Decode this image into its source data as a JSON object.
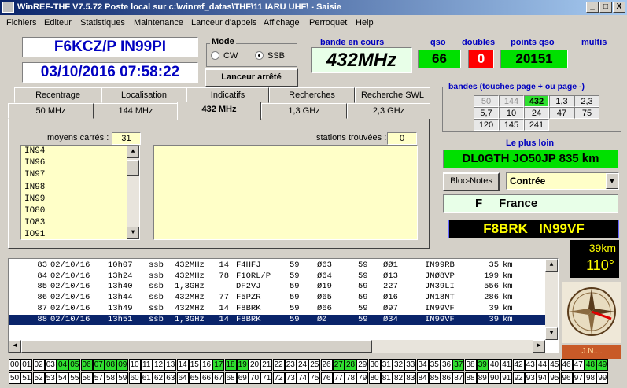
{
  "window": {
    "title": "WinREF-THF V7.5.72 Poste local sur c:\\winref_datas\\THF\\11 IARU UHF\\ -  Saisie",
    "min": "_",
    "max": "□",
    "close": "X"
  },
  "menu": [
    "Fichiers",
    "Editeur",
    "Statistiques",
    "Maintenance",
    "Lanceur d'appels",
    "Affichage",
    "Perroquet",
    "Help"
  ],
  "station": {
    "callsign": "F6KCZ/P  IN99PI",
    "datetime": "03/10/2016   07:58:22"
  },
  "mode": {
    "label": "Mode",
    "cw": "CW",
    "ssb": "SSB",
    "selected": "SSB"
  },
  "launcher_button": "Lanceur arrêté",
  "band": {
    "label": "bande en cours",
    "value": "432MHz"
  },
  "qso": {
    "label": "qso",
    "value": "66"
  },
  "doubles": {
    "label": "doubles",
    "value": "0"
  },
  "points": {
    "label": "points qso",
    "value": "20151"
  },
  "multis": {
    "label": "multis"
  },
  "tabs_top": [
    "Recentrage",
    "Localisation",
    "Indicatifs",
    "Recherches",
    "Recherche SWL"
  ],
  "tabs_bands": [
    "50 MHz",
    "144 MHz",
    "432 MHz",
    "1,3 GHz",
    "2,3 GHz"
  ],
  "active_band_tab": "432 MHz",
  "squares": {
    "label": "moyens carrés :",
    "count": "31",
    "items": [
      "IN94",
      "IN96",
      "IN97",
      "IN98",
      "IN99",
      "IO80",
      "IO83",
      "IO91"
    ]
  },
  "stations": {
    "label": "stations trouvées :",
    "count": "0"
  },
  "bands_panel": {
    "title": "bandes (touches page + ou page -)",
    "rows": [
      [
        "50",
        "144",
        "432",
        "1,3",
        "2,3"
      ],
      [
        "5,7",
        "10",
        "24",
        "47",
        "75"
      ],
      [
        "120",
        "145",
        "241"
      ]
    ],
    "active": "432",
    "greyed": [
      "50",
      "144"
    ]
  },
  "farthest": {
    "label": "Le plus loin",
    "value": "DL0GTH JO50JP  835 km"
  },
  "notes_button": "Bloc-Notes",
  "contest_select": "Contrée",
  "country": "F     France",
  "current": {
    "call": "F8BRK   IN99VF",
    "distance": "39km",
    "bearing": "110°"
  },
  "compass_label": "J.N....",
  "log": [
    [
      "83",
      "02/10/16",
      "10h07",
      "ssb",
      "432MHz",
      "14",
      "F4HFJ",
      "59",
      "Ø63",
      "59",
      "ØØ1",
      "IN99RB",
      "35",
      "km"
    ],
    [
      "84",
      "02/10/16",
      "13h24",
      "ssb",
      "432MHz",
      "78",
      "F1ORL/P",
      "59",
      "Ø64",
      "59",
      "Ø13",
      "JNØ8VP",
      "199",
      "km"
    ],
    [
      "85",
      "02/10/16",
      "13h40",
      "ssb",
      "1,3GHz",
      "",
      "DF2VJ",
      "59",
      "Ø19",
      "59",
      "227",
      "JN39LI",
      "556",
      "km"
    ],
    [
      "86",
      "02/10/16",
      "13h44",
      "ssb",
      "432MHz",
      "77",
      "F5PZR",
      "59",
      "Ø65",
      "59",
      "Ø16",
      "JN18NT",
      "286",
      "km"
    ],
    [
      "87",
      "02/10/16",
      "13h49",
      "ssb",
      "432MHz",
      "14",
      "F8BRK",
      "59",
      "Ø66",
      "59",
      "Ø97",
      "IN99VF",
      "39",
      "km"
    ],
    [
      "88",
      "02/10/16",
      "13h51",
      "ssb",
      "1,3GHz",
      "14",
      "F8BRK",
      "59",
      "ØØ",
      "59",
      "Ø34",
      "IN99VF",
      "39",
      "km"
    ]
  ],
  "selected_log_row": "88",
  "scroll": {
    "up": "▲",
    "down": "▼",
    "left": "◄",
    "right": "►"
  },
  "departments": {
    "row1": [
      "00",
      "01",
      "02",
      "03",
      "04",
      "05",
      "06",
      "07",
      "08",
      "09",
      "10",
      "11",
      "12",
      "13",
      "14",
      "15",
      "16",
      "17",
      "18",
      "19",
      "20",
      "21",
      "22",
      "23",
      "24",
      "25",
      "26",
      "27",
      "28",
      "29",
      "30",
      "31",
      "32",
      "33",
      "34",
      "35",
      "36",
      "37",
      "38",
      "39",
      "40",
      "41",
      "42",
      "43",
      "44",
      "45",
      "46",
      "47",
      "48",
      "49"
    ],
    "row2": [
      "50",
      "51",
      "52",
      "53",
      "54",
      "55",
      "56",
      "57",
      "58",
      "59",
      "60",
      "61",
      "62",
      "63",
      "64",
      "65",
      "66",
      "67",
      "68",
      "69",
      "70",
      "71",
      "72",
      "73",
      "74",
      "75",
      "76",
      "77",
      "78",
      "79",
      "80",
      "81",
      "82",
      "83",
      "84",
      "85",
      "86",
      "87",
      "88",
      "89",
      "90",
      "91",
      "92",
      "93",
      "94",
      "95",
      "96",
      "97",
      "98",
      "99"
    ],
    "worked": [
      "04",
      "05",
      "06",
      "07",
      "08",
      "09",
      "17",
      "18",
      "19",
      "27",
      "28",
      "37",
      "39",
      "48",
      "49"
    ],
    "green_color": "#30e030"
  },
  "colors": {
    "accent_blue": "#0000c0",
    "lcd_green": "#00e000",
    "red": "#ff0000",
    "selection": "#0a246a"
  }
}
